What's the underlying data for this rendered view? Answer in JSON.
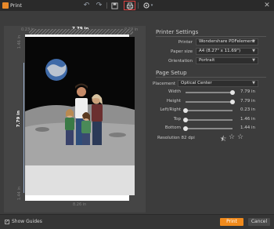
{
  "window": {
    "title": "Print"
  },
  "toolbar": {
    "icons": [
      "undo-icon",
      "redo-icon",
      "save-icon",
      "print-icon",
      "crop-icon",
      "settings-icon"
    ]
  },
  "preview": {
    "top_width": "7.79 in",
    "left_height": "7.79 in",
    "top_margin_left": "0.23 in",
    "top_margin_right": "0.23 in",
    "left_margin_top": "1.46 in",
    "left_margin_bottom": "1.44 in",
    "bottom_width": "8.26 in"
  },
  "printer_settings": {
    "title": "Printer Settings",
    "printer_label": "Printer",
    "printer_value": "Wondershare PDFelement",
    "paper_size_label": "Paper size",
    "paper_size_value": "A4 (8.27\" x 11.69\")",
    "orientation_label": "Orientation",
    "orientation_value": "Portrait"
  },
  "page_setup": {
    "title": "Page Setup",
    "placement_label": "Placement",
    "placement_value": "Optical Center",
    "sliders": [
      {
        "label": "Width",
        "value": "7.79 in",
        "level": 1.0
      },
      {
        "label": "Height",
        "value": "7.79 in",
        "level": 1.0
      },
      {
        "label": "Left/Right",
        "value": "0.23 in",
        "level": 0.0
      },
      {
        "label": "Top",
        "value": "1.46 in",
        "level": 0.0
      },
      {
        "label": "Bottom",
        "value": "1.44 in",
        "level": 0.0
      }
    ],
    "resolution_label": "Resolution 82 dpi",
    "stars_filled": 0.5,
    "stars_total": 3
  },
  "footer": {
    "show_guides_label": "Show Guides",
    "show_guides_checked": true,
    "print_label": "Print",
    "cancel_label": "Cancel"
  },
  "colors": {
    "accent": "#f08a1c",
    "background": "#3c3c3c",
    "titlebar": "#2a2a2a"
  }
}
